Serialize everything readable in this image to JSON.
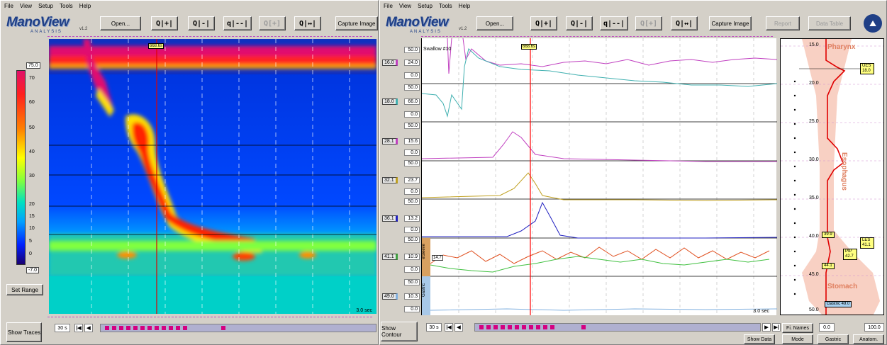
{
  "menu": [
    "File",
    "View",
    "Setup",
    "Tools",
    "Help"
  ],
  "app": {
    "name": "ManoView",
    "subtitle": "ANALYSIS",
    "version": "v1.2"
  },
  "toolbar": {
    "open": "Open...",
    "capture": "Capture Image",
    "report": "Report",
    "data_table": "Data Table"
  },
  "contour": {
    "scale_max": "75.0",
    "scale_min": "-7.0",
    "scale_ticks": [
      "70",
      "60",
      "50",
      "40",
      "30",
      "20",
      "15",
      "10",
      "5",
      "0"
    ],
    "set_range": "Set Range",
    "time_marker": "668.6s",
    "scale_bar": "3.0 sec",
    "show_traces": "Show Traces",
    "duration": "30 s"
  },
  "traces": {
    "swallow": "Swallow #10",
    "time_marker": "668.6s",
    "scale_bar": "3.0 sec",
    "show_contour": "Show Contour",
    "duration": "30 s",
    "show_data": "Show Data",
    "sleeve_label": "eSleeve",
    "gastric_label": "Gastric",
    "sleeve_value": "14.7",
    "channels": [
      {
        "pos": "16.0",
        "top": "50.0",
        "val": "24.0",
        "bot": "0.0",
        "color": "#c040c0"
      },
      {
        "pos": "18.0",
        "top": "50.0",
        "val": "66.0",
        "bot": "0.0",
        "color": "#40b0b0"
      },
      {
        "pos": "28.1",
        "top": "50.0",
        "val": "15.6",
        "bot": "0.0",
        "color": "#c040c0"
      },
      {
        "pos": "32.1",
        "top": "50.0",
        "val": "23.7",
        "bot": "0.0",
        "color": "#c0a020"
      },
      {
        "pos": "36.1",
        "top": "50.0",
        "val": "13.2",
        "bot": "0.0",
        "color": "#2020c0"
      },
      {
        "pos": "41.1",
        "top": "50.0",
        "val": "10.9",
        "bot": "0.0",
        "color": "#40a040"
      },
      {
        "pos": "49.0",
        "top": "50.0",
        "val": "10.3",
        "bot": "0.0",
        "color": "#80b0e0"
      }
    ]
  },
  "anatomy": {
    "ticks": [
      "15.0",
      "20.0",
      "25.0",
      "30.0",
      "35.0",
      "40.0",
      "45.0",
      "50.0"
    ],
    "pharynx": "Pharynx",
    "esophagus": "Esophagus",
    "stomach": "Stomach",
    "ues": "UES 18.0",
    "les": "LES 41.1",
    "pip": "PIP 42.7",
    "m1": "39.9",
    "m2": "44.1",
    "gastric": "Gastric 49.0",
    "fi_names": "Fi. Names",
    "range_min": "0.0",
    "range_max": "100.0",
    "mode": "Mode",
    "gastric_btn": "Gastric",
    "anatom": "Anatom."
  },
  "colors": {
    "accent": "#1f3f86",
    "time_marker": "#ff0000"
  }
}
